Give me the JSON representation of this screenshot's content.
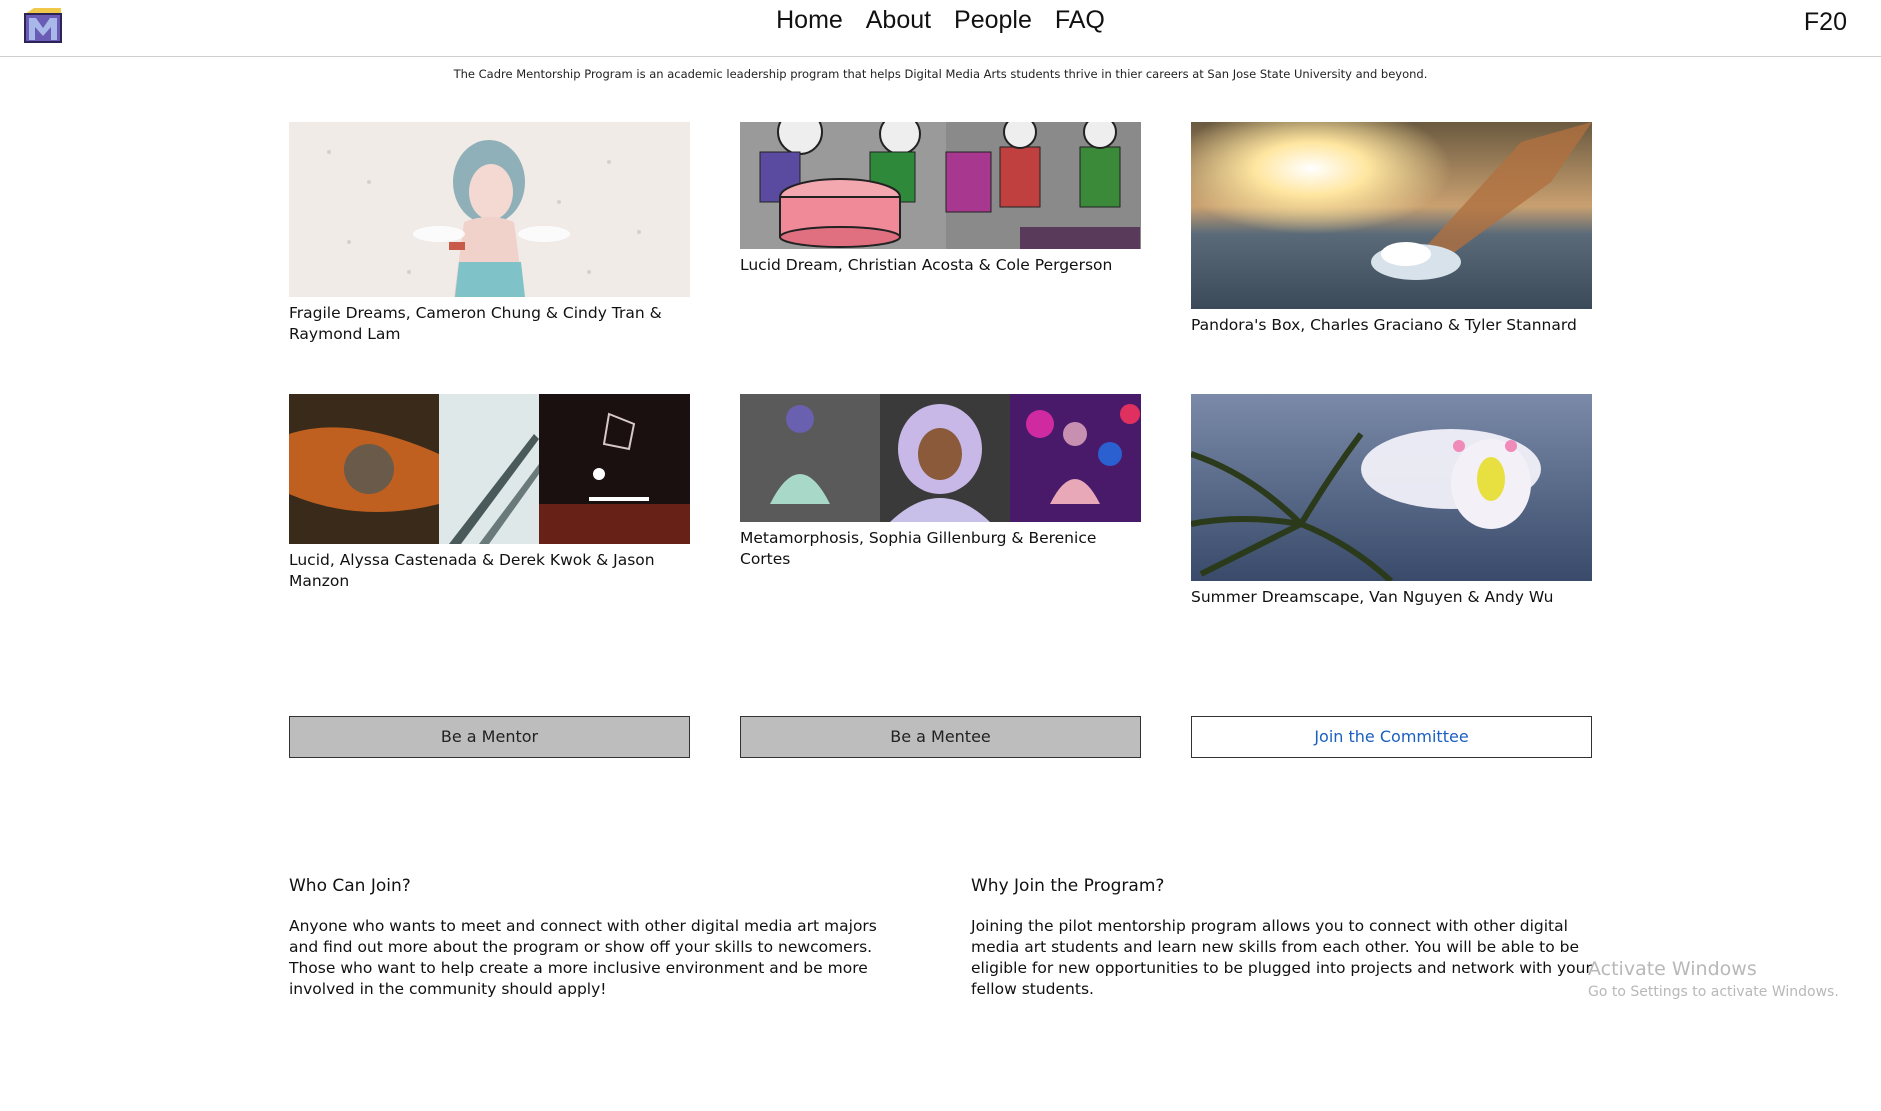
{
  "header": {
    "nav": [
      "Home",
      "About",
      "People",
      "FAQ"
    ],
    "term": "F20",
    "tagline": "The Cadre Mentorship Program is an academic leadership program that helps Digital Media Arts students thrive in thier careers at San Jose State University and beyond."
  },
  "projects": [
    {
      "caption": "Fragile Dreams, Cameron Chung & Cindy Tran & Raymond Lam"
    },
    {
      "caption": "Lucid Dream, Christian Acosta & Cole Pergerson"
    },
    {
      "caption": "Pandora's Box, Charles Graciano & Tyler Stannard"
    },
    {
      "caption": "Lucid, Alyssa Castenada & Derek Kwok & Jason Manzon"
    },
    {
      "caption": "Metamorphosis, Sophia Gillenburg & Berenice Cortes"
    },
    {
      "caption": "Summer Dreamscape, Van Nguyen & Andy Wu"
    }
  ],
  "buttons": {
    "mentor": "Be a Mentor",
    "mentee": "Be a Mentee",
    "committee": "Join the Committee"
  },
  "info": {
    "who_title": "Who Can Join?",
    "who_text": "Anyone who wants to meet and connect with other digital media art majors and find out more about the program or show off your skills to newcomers. Those who want to help create a more inclusive environment and be more involved in the community should apply!",
    "why_title": "Why Join the Program?",
    "why_text": "Joining the pilot mentorship program allows you to connect with other digital media art students and learn new skills from each other. You will be able to be eligible for new opportunities to be plugged into projects and network with your fellow students."
  },
  "watermark": {
    "line1": "Activate Windows",
    "line2": "Go to Settings to activate Windows."
  },
  "colors": {
    "button_gray": "#bdbdbd",
    "link_blue": "#1a5fc0",
    "logo_purple": "#5b4a9e"
  }
}
